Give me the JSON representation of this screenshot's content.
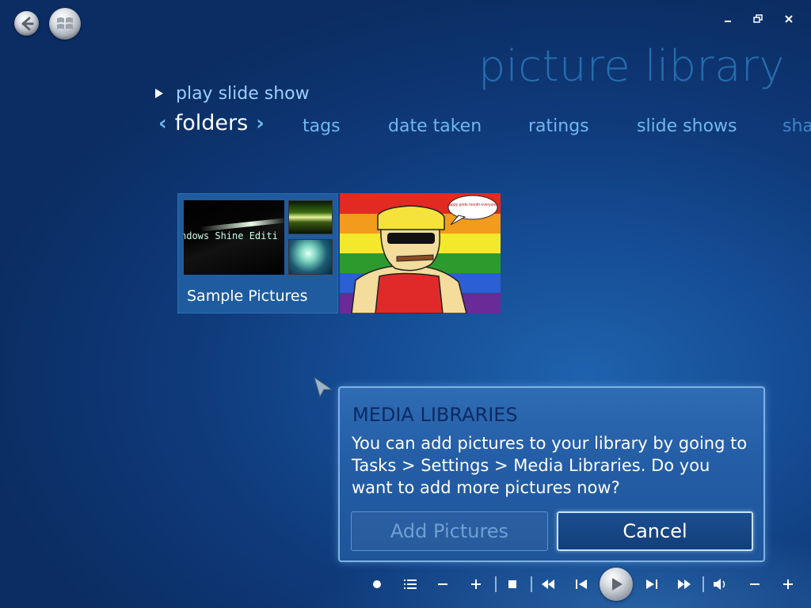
{
  "header": {
    "page_title": "picture library",
    "back_icon": "back-arrow-icon",
    "start_icon": "windows-logo-icon",
    "window_controls": {
      "minimize": "minimize-icon",
      "restore": "restore-icon",
      "close": "close-icon"
    }
  },
  "actions": {
    "play_slide_show": "play slide show"
  },
  "tabs": {
    "active": "folders",
    "prev_chevron": "‹",
    "next_chevron": "›",
    "items": [
      "tags",
      "date taken",
      "ratings",
      "slide shows",
      "sha"
    ]
  },
  "tiles": {
    "folder": {
      "label": "Sample Pictures",
      "thumb_text": "ndows Shine Editi"
    },
    "picture": {
      "speech_text": "happy pride month everyone!"
    }
  },
  "dialog": {
    "title": "MEDIA LIBRARIES",
    "body": "You can add pictures to your library by going to Tasks > Settings > Media Libraries. Do you want to add more pictures now?",
    "add_button": "Add Pictures",
    "cancel_button": "Cancel"
  },
  "transport": {
    "icons": [
      "record-icon",
      "playlist-icon",
      "minus-icon",
      "plus-icon",
      "stop-icon",
      "rewind-icon",
      "previous-icon",
      "play-icon",
      "next-icon",
      "fast-forward-icon",
      "volume-icon",
      "volume-down-icon",
      "volume-up-icon"
    ]
  },
  "colors": {
    "background": "#154d95",
    "title": "#2a78b9",
    "tab_inactive": "#6fb7f0",
    "dialog_bg": "#245ea6",
    "dialog_title": "#0c2a63"
  }
}
